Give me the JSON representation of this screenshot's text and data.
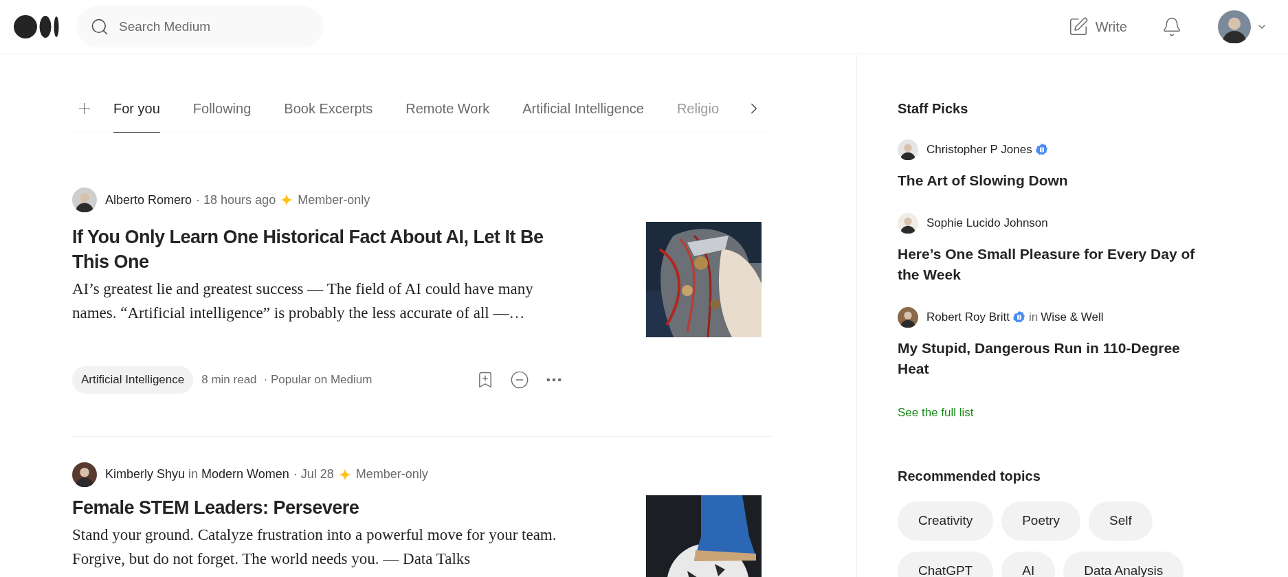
{
  "header": {
    "search": {
      "placeholder": "Search Medium"
    },
    "write": "Write"
  },
  "tabs": [
    {
      "label": "For you",
      "selected": true
    },
    {
      "label": "Following",
      "selected": false
    },
    {
      "label": "Book Excerpts",
      "selected": false
    },
    {
      "label": "Remote Work",
      "selected": false
    },
    {
      "label": "Artificial Intelligence",
      "selected": false
    },
    {
      "label": "Religio",
      "selected": false,
      "faded": true
    }
  ],
  "articles": [
    {
      "author": "Alberto Romero",
      "time": "· 18 hours ago",
      "badge": "Member-only",
      "title": "If You Only Learn One Historical Fact About AI, Let It Be This One",
      "description": "AI’s greatest lie and greatest success — The field of AI could have many names. “Artificial intelligence” is probably the less accurate of all —…",
      "tag": "Artificial Intelligence",
      "read_time": "8 min read",
      "note": "· Popular on Medium"
    },
    {
      "author": "Kimberly Shyu",
      "in": "in",
      "publication": "Modern Women",
      "time": "· Jul 28",
      "badge": "Member-only",
      "title": "Female STEM Leaders: Persevere",
      "description": "Stand your ground. Catalyze frustration into a powerful move for your team. Forgive, but do not forget. The world needs you. — Data Talks"
    }
  ],
  "staff_picks": {
    "title": "Staff Picks",
    "items": [
      {
        "author": "Christopher P Jones",
        "verified": true,
        "title": "The Art of Slowing Down"
      },
      {
        "author": "Sophie Lucido Johnson",
        "verified": false,
        "title": "Here’s One Small Pleasure for Every Day of the Week"
      },
      {
        "author": "Robert Roy Britt",
        "verified": true,
        "in": "in",
        "publication": "Wise & Well",
        "title": "My Stupid, Dangerous Run in 110-Degree Heat"
      }
    ],
    "link": "See the full list"
  },
  "recommended_topics": {
    "title": "Recommended topics",
    "items": [
      "Creativity",
      "Poetry",
      "Self",
      "ChatGPT",
      "AI",
      "Data Analysis"
    ]
  }
}
